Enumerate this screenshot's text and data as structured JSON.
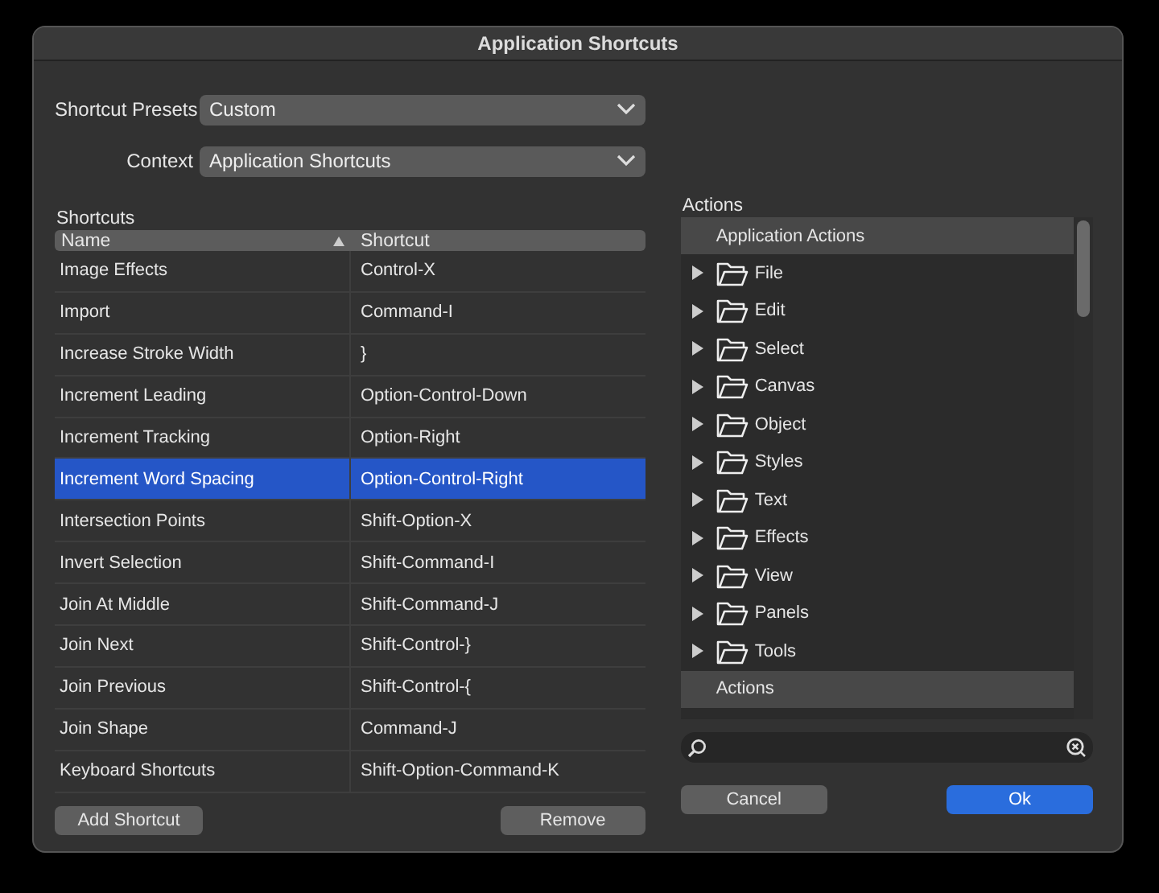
{
  "window": {
    "title": "Application Shortcuts"
  },
  "presets": {
    "label": "Shortcut Presets",
    "value": "Custom"
  },
  "context": {
    "label": "Context",
    "value": "Application Shortcuts"
  },
  "shortcuts": {
    "label": "Shortcuts",
    "columns": [
      {
        "title": "Name",
        "sorted": true
      },
      {
        "title": "Shortcut",
        "sorted": false
      }
    ],
    "rows": [
      {
        "name": "Image Effects",
        "shortcut": "Control-X",
        "selected": false
      },
      {
        "name": "Import",
        "shortcut": "Command-I",
        "selected": false
      },
      {
        "name": "Increase Stroke Width",
        "shortcut": "}",
        "selected": false
      },
      {
        "name": "Increment Leading",
        "shortcut": "Option-Control-Down",
        "selected": false
      },
      {
        "name": "Increment Tracking",
        "shortcut": "Option-Right",
        "selected": false
      },
      {
        "name": "Increment Word Spacing",
        "shortcut": "Option-Control-Right",
        "selected": true
      },
      {
        "name": "Intersection Points",
        "shortcut": "Shift-Option-X",
        "selected": false
      },
      {
        "name": "Invert Selection",
        "shortcut": "Shift-Command-I",
        "selected": false
      },
      {
        "name": "Join At Middle",
        "shortcut": "Shift-Command-J",
        "selected": false
      },
      {
        "name": "Join Next",
        "shortcut": "Shift-Control-}",
        "selected": false
      },
      {
        "name": "Join Previous",
        "shortcut": "Shift-Control-{",
        "selected": false
      },
      {
        "name": "Join Shape",
        "shortcut": "Command-J",
        "selected": false
      },
      {
        "name": "Keyboard Shortcuts",
        "shortcut": "Shift-Option-Command-K",
        "selected": false
      }
    ]
  },
  "actions": {
    "label": "Actions",
    "groups": [
      {
        "title": "Application Actions",
        "children": [
          {
            "label": "File",
            "expanded": false
          },
          {
            "label": "Edit",
            "expanded": false
          },
          {
            "label": "Select",
            "expanded": false
          },
          {
            "label": "Canvas",
            "expanded": false
          },
          {
            "label": "Object",
            "expanded": false
          },
          {
            "label": "Styles",
            "expanded": false
          },
          {
            "label": "Text",
            "expanded": false
          },
          {
            "label": "Effects",
            "expanded": false
          },
          {
            "label": "View",
            "expanded": false
          },
          {
            "label": "Panels",
            "expanded": false
          },
          {
            "label": "Tools",
            "expanded": false
          }
        ]
      },
      {
        "title": "Actions"
      }
    ]
  },
  "left_buttons": [
    {
      "label": "Add Shortcut"
    },
    {
      "label": "Remove"
    }
  ],
  "right_buttons": [
    {
      "label": "Cancel",
      "default": false
    },
    {
      "label": "Ok",
      "default": true
    }
  ]
}
